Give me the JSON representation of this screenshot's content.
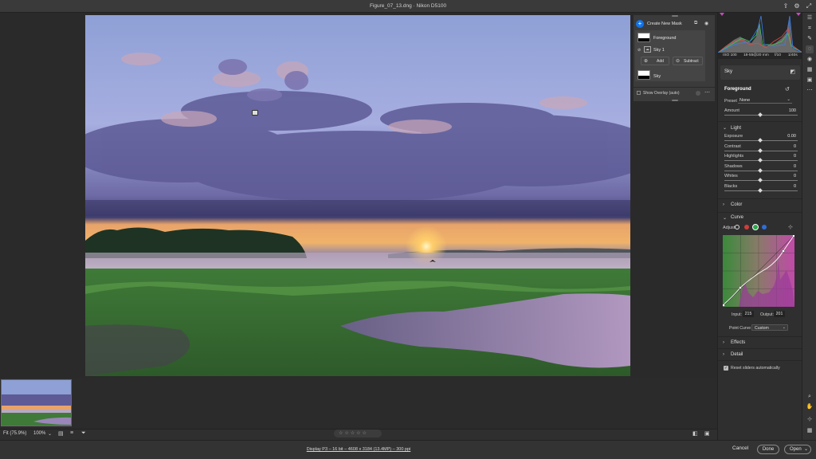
{
  "window": {
    "title": "Figure_07_13.dng  ·  Nikon D5100"
  },
  "masks_panel": {
    "create_label": "Create New Mask",
    "items": [
      {
        "name": "Foreground",
        "components": [
          {
            "name": "Sky 1"
          }
        ],
        "add_label": "Add",
        "subtract_label": "Subtract"
      },
      {
        "name": "Sky"
      }
    ],
    "show_overlay_label": "Show Overlay (auto)"
  },
  "histogram": {
    "iso": "ISO 100",
    "lens": "18-55@20 mm",
    "aperture": "f/10",
    "shutter": "1/40s"
  },
  "right_panel": {
    "mask_selected": "Sky",
    "edit_title": "Foreground",
    "preset_label": "Preset",
    "preset_value": "None",
    "amount_label": "Amount",
    "amount_value": "100",
    "light": {
      "title": "Light",
      "sliders": [
        {
          "label": "Exposure",
          "value": "0.00"
        },
        {
          "label": "Contrast",
          "value": "0"
        },
        {
          "label": "Highlights",
          "value": "0"
        },
        {
          "label": "Shadows",
          "value": "0"
        },
        {
          "label": "Whites",
          "value": "0"
        },
        {
          "label": "Blacks",
          "value": "0"
        }
      ]
    },
    "color_title": "Color",
    "curve": {
      "title": "Curve",
      "adjust_label": "Adjust",
      "input_label": "Input:",
      "input_value": "215",
      "output_label": "Output:",
      "output_value": "201",
      "point_curve_label": "Point Curve",
      "point_curve_value": "Custom"
    },
    "effects_title": "Effects",
    "detail_title": "Detail",
    "reset_label": "Reset sliders automatically",
    "reset_checked": true
  },
  "status": {
    "zoom_fit": "Fit (75.9%)",
    "zoom_100": "100%",
    "file_info": "Display P3 – 16 bit – 4608 x 3184 (13.4MP) – 300 ppi"
  },
  "footer": {
    "cancel_label": "Cancel",
    "done_label": "Done",
    "open_label": "Open"
  },
  "icons": {
    "share": "share-icon",
    "settings": "gear-icon",
    "expand": "expand-icon",
    "tools": [
      "edit-sliders-icon",
      "crop-icon",
      "healing-icon",
      "masking-icon",
      "red-eye-icon",
      "presets-icon",
      "snapshots-icon",
      "more-icon",
      "zoom-icon",
      "hand-icon",
      "sampler-icon",
      "grid-icon"
    ]
  },
  "colors": {
    "accent": "#1473e6",
    "panel": "#2f2f2f",
    "selected_tool": "#4a4a4a"
  },
  "rating": {
    "stars": 0,
    "max": 5
  }
}
